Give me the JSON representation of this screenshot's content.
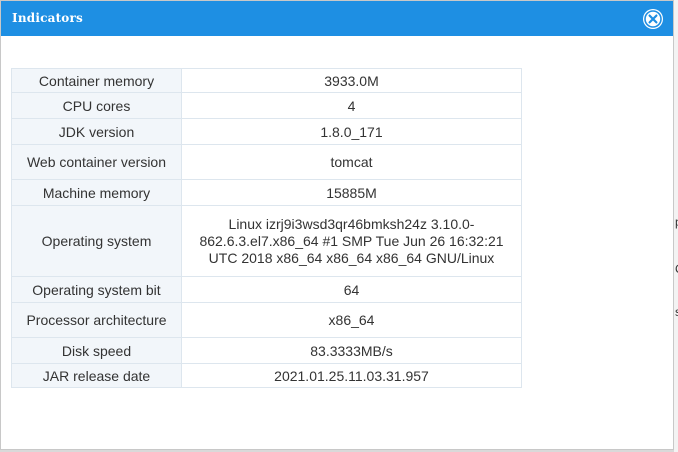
{
  "dialog": {
    "title": "Indicators",
    "close_icon": "close-icon",
    "accent_color": "#1e8fe3"
  },
  "background": {
    "fragments": [
      "p",
      "C",
      "s"
    ]
  },
  "table": {
    "rows": [
      {
        "label": "Container memory",
        "value": "3933.0M"
      },
      {
        "label": "CPU cores",
        "value": "4"
      },
      {
        "label": "JDK version",
        "value": "1.8.0_171"
      },
      {
        "label": "Web container version",
        "value": "tomcat"
      },
      {
        "label": "Machine memory",
        "value": "15885M"
      },
      {
        "label": "Operating system",
        "value": "Linux izrj9i3wsd3qr46bmksh24z 3.10.0-862.6.3.el7.x86_64 #1 SMP Tue Jun 26 16:32:21 UTC 2018 x86_64 x86_64 x86_64 GNU/Linux"
      },
      {
        "label": "Operating system bit",
        "value": "64"
      },
      {
        "label": "Processor architecture",
        "value": "x86_64"
      },
      {
        "label": "Disk speed",
        "value": "83.3333MB/s"
      },
      {
        "label": "JAR release date",
        "value": "2021.01.25.11.03.31.957"
      }
    ]
  }
}
